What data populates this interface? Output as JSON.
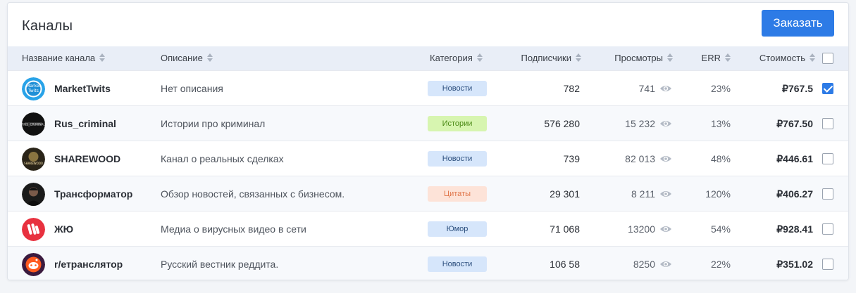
{
  "page": {
    "title": "Каналы",
    "order_button": "Заказать"
  },
  "colors": {
    "accent": "#2d7be6",
    "badge_news": {
      "bg": "#d6e6fb",
      "fg": "#2a4d7c"
    },
    "badge_stories": {
      "bg": "#d7f5b0",
      "fg": "#4b8a16"
    },
    "badge_quotes": {
      "bg": "#fde3d8",
      "fg": "#e0764a"
    },
    "badge_humor": {
      "bg": "#d6e6fb",
      "fg": "#2a4d7c"
    }
  },
  "table": {
    "columns": {
      "name": "Название канала",
      "description": "Описание",
      "category": "Категория",
      "subscribers": "Подписчики",
      "views": "Просмотры",
      "err": "ERR",
      "price": "Стоимость"
    },
    "select_all_checked": false,
    "rows": [
      {
        "avatar": "markettwits-logo",
        "name": "MarketTwits",
        "description": "Нет описания",
        "category": "Новости",
        "category_style": "news",
        "subscribers": "782",
        "views": "741",
        "err": "23%",
        "price": "₽767.5",
        "checked": true
      },
      {
        "avatar": "rus-criminal-logo",
        "name": "Rus_criminal",
        "description": "Истории про криминал",
        "category": "Истории",
        "category_style": "stories",
        "subscribers": "576 280",
        "views": "15 232",
        "err": "13%",
        "price": "₽767.50",
        "checked": false
      },
      {
        "avatar": "sharewood-logo",
        "name": "SHAREWOOD",
        "description": "Канал о реальных сделках",
        "category": "Новости",
        "category_style": "news",
        "subscribers": "739",
        "views": "82 013",
        "err": "48%",
        "price": "₽446.61",
        "checked": false
      },
      {
        "avatar": "transformator-avatar",
        "name": "Трансформатор",
        "description": "Обзор новостей, связанных с бизнесом.",
        "category": "Цитаты",
        "category_style": "quotes",
        "subscribers": "29 301",
        "views": "8 211",
        "err": "120%",
        "price": "₽406.27",
        "checked": false
      },
      {
        "avatar": "zhyu-logo",
        "name": "ЖЮ",
        "description": "Медиа о вирусных видео в сети",
        "category": "Юмор",
        "category_style": "humor",
        "subscribers": "71 068",
        "views": "13200",
        "err": "54%",
        "price": "₽928.41",
        "checked": false
      },
      {
        "avatar": "r-translator-logo",
        "name": "r/етранслятор",
        "description": "Русский вестник реддита.",
        "category": "Новости",
        "category_style": "news",
        "subscribers": "106 58",
        "views": "8250",
        "err": "22%",
        "price": "₽351.02",
        "checked": false
      }
    ]
  }
}
